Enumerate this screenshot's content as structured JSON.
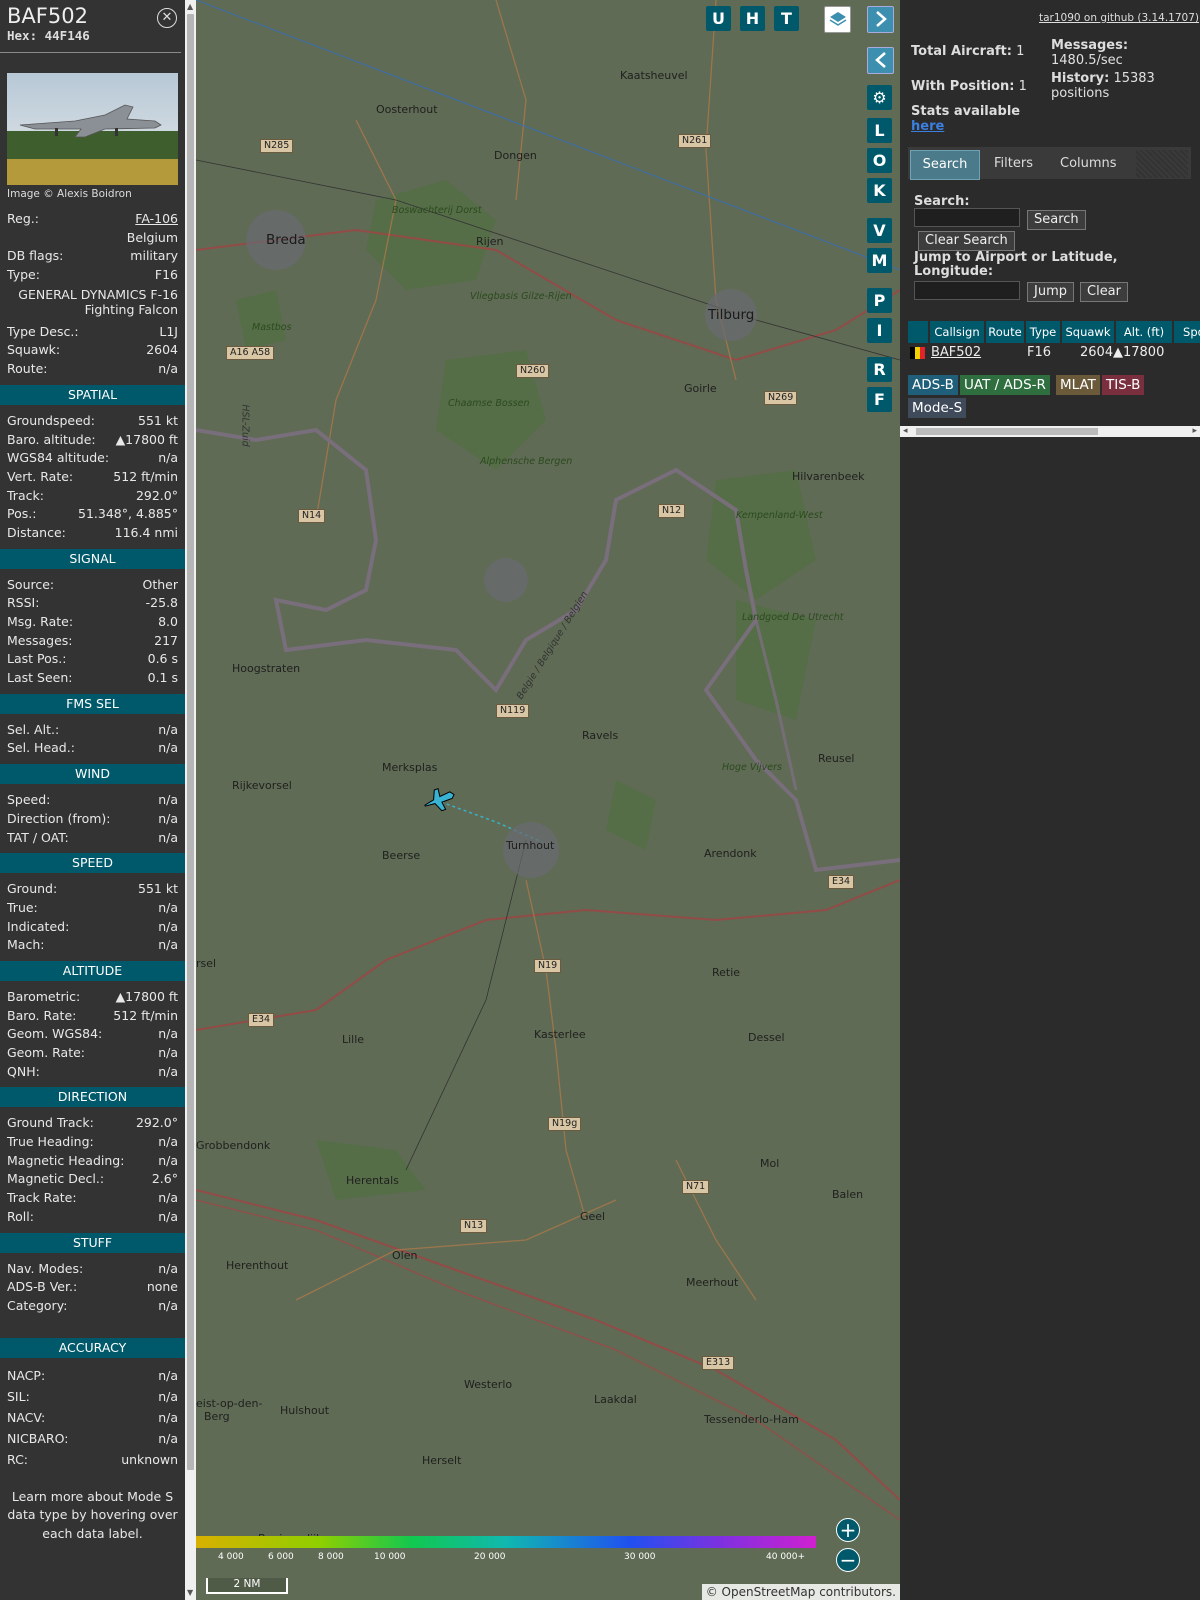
{
  "aircraft": {
    "callsign": "BAF502",
    "hex": "Hex: 44F146",
    "photo_credit": "Image © Alexis Boidron",
    "reg_label": "Reg.:",
    "reg": "FA-106",
    "country": "Belgium",
    "dbflags_label": "DB flags:",
    "dbflags": "military",
    "type_label": "Type:",
    "type": "F16",
    "type_full": "GENERAL DYNAMICS F-16 Fighting Falcon",
    "typedesc_label": "Type Desc.:",
    "typedesc": "L1J",
    "squawk_label": "Squawk:",
    "squawk": "2604",
    "route_label": "Route:",
    "route": "n/a"
  },
  "sections": [
    {
      "title": "SPATIAL",
      "rows": [
        {
          "k": "Groundspeed:",
          "v": "551 kt"
        },
        {
          "k": "Baro. altitude:",
          "v": "▲17800 ft"
        },
        {
          "k": "WGS84 altitude:",
          "v": "n/a"
        },
        {
          "k": "Vert. Rate:",
          "v": "512 ft/min"
        },
        {
          "k": "Track:",
          "v": "292.0°"
        },
        {
          "k": "Pos.:",
          "v": "51.348°, 4.885°"
        },
        {
          "k": "Distance:",
          "v": "116.4 nmi"
        }
      ]
    },
    {
      "title": "SIGNAL",
      "rows": [
        {
          "k": "Source:",
          "v": "Other"
        },
        {
          "k": "RSSI:",
          "v": "-25.8"
        },
        {
          "k": "Msg. Rate:",
          "v": "8.0"
        },
        {
          "k": "Messages:",
          "v": "217"
        },
        {
          "k": "Last Pos.:",
          "v": "0.6 s"
        },
        {
          "k": "Last Seen:",
          "v": "0.1 s"
        }
      ]
    },
    {
      "title": "FMS SEL",
      "rows": [
        {
          "k": "Sel. Alt.:",
          "v": "n/a"
        },
        {
          "k": "Sel. Head.:",
          "v": "n/a"
        }
      ]
    },
    {
      "title": "WIND",
      "rows": [
        {
          "k": "Speed:",
          "v": "n/a"
        },
        {
          "k": "Direction (from):",
          "v": "n/a"
        },
        {
          "k": "TAT / OAT:",
          "v": "n/a"
        }
      ]
    },
    {
      "title": "SPEED",
      "rows": [
        {
          "k": "Ground:",
          "v": "551 kt"
        },
        {
          "k": "True:",
          "v": "n/a"
        },
        {
          "k": "Indicated:",
          "v": "n/a"
        },
        {
          "k": "Mach:",
          "v": "n/a"
        }
      ]
    },
    {
      "title": "ALTITUDE",
      "rows": [
        {
          "k": "Barometric:",
          "v": "▲17800 ft"
        },
        {
          "k": "Baro. Rate:",
          "v": "512 ft/min"
        },
        {
          "k": "Geom. WGS84:",
          "v": "n/a"
        },
        {
          "k": "Geom. Rate:",
          "v": "n/a"
        },
        {
          "k": "QNH:",
          "v": "n/a"
        }
      ]
    },
    {
      "title": "DIRECTION",
      "rows": [
        {
          "k": "Ground Track:",
          "v": "292.0°"
        },
        {
          "k": "True Heading:",
          "v": "n/a"
        },
        {
          "k": "Magnetic Heading:",
          "v": "n/a"
        },
        {
          "k": "Magnetic Decl.:",
          "v": "2.6°"
        },
        {
          "k": "Track Rate:",
          "v": "n/a"
        },
        {
          "k": "Roll:",
          "v": "n/a"
        }
      ]
    },
    {
      "title": "STUFF",
      "rows": [
        {
          "k": "Nav. Modes:",
          "v": "n/a"
        },
        {
          "k": "ADS-B Ver.:",
          "v": "none"
        },
        {
          "k": "Category:",
          "v": "n/a"
        }
      ]
    },
    {
      "title": "ACCURACY",
      "rows": [
        {
          "k": "NACP:",
          "v": "n/a"
        },
        {
          "k": "SIL:",
          "v": "n/a"
        },
        {
          "k": "NACV:",
          "v": "n/a"
        },
        {
          "k": "NICBARO:",
          "v": "n/a"
        },
        {
          "k": "RC:",
          "v": "unknown"
        }
      ]
    }
  ],
  "learn_more": "Learn more about Mode S data type by hovering over each data label.",
  "map": {
    "top_buttons": [
      "U",
      "H",
      "T"
    ],
    "side_buttons": [
      "L",
      "O",
      "K",
      "V",
      "M",
      "P",
      "I",
      "R",
      "F"
    ],
    "attribution": "© OpenStreetMap contributors.",
    "scale": "2 NM",
    "altitude_legend": [
      "4 000",
      "6 000",
      "8 000",
      "10 000",
      "20 000",
      "30 000",
      "40 000+"
    ],
    "places": [
      "Breda",
      "Tilburg",
      "Oosterhout",
      "Dongen",
      "Kaatsheuvel",
      "Rijen",
      "Goirle",
      "Hilvarenbeek",
      "Hoogstraten",
      "Merksplas",
      "Rijkevorsel",
      "Ravels",
      "Turnhout",
      "Beerse",
      "Arendonk",
      "Reusel",
      "Retie",
      "Kasterlee",
      "Dessel",
      "Lille",
      "Grobbendonk",
      "Herentals",
      "Geel",
      "Mol",
      "Balen",
      "Olen",
      "Herenthout",
      "Meerhout",
      "Westerlo",
      "Laakdal",
      "Hulshout",
      "Herselt",
      "Tessenderlo-Ham",
      "Beginendijk",
      "Berg",
      "rsel",
      "eist-op-den-"
    ],
    "roads": [
      "N285",
      "N261",
      "N260",
      "N269",
      "N14",
      "N12",
      "N119",
      "N19",
      "N19g",
      "N71",
      "N13",
      "E313",
      "E34",
      "E34",
      "A16 A58"
    ],
    "areas": [
      "Boswachterij Dorst",
      "Vliegbasis Gilze-Rijen",
      "Mastbos",
      "Chaamse Bossen",
      "Alphensche Bergen",
      "Kempenland-West",
      "Landgoed De Utrecht",
      "Hoge Vijvers",
      "Belgie / Belgique / Belgien",
      "HSL-Zuid"
    ]
  },
  "stats": {
    "total_label": "Total Aircraft:",
    "total": "1",
    "withpos_label": "With Position:",
    "withpos": "1",
    "messages_label": "Messages:",
    "messages": "1480.5/sec",
    "history_label": "History:",
    "history": "15383 positions",
    "stats_label": "Stats available",
    "stats_link": "here",
    "github": "tar1090 on github (3.14.1707)"
  },
  "tabs": [
    "Search",
    "Filters",
    "Columns"
  ],
  "search": {
    "label": "Search:",
    "search_button": "Search",
    "clear_button": "Clear Search",
    "jump_label": "Jump to Airport or Latitude, Longitude:",
    "jump_button": "Jump",
    "jump_clear_button": "Clear"
  },
  "table": {
    "headers": [
      "Callsign",
      "Route",
      "Type",
      "Squawk",
      "Alt. (ft)",
      "Spd"
    ],
    "row": {
      "callsign": "BAF502",
      "type": "F16",
      "squawk": "2604",
      "alt": "▲17800"
    }
  },
  "sources": [
    {
      "label": "ADS-B",
      "color": "#1f5f7a"
    },
    {
      "label": "UAT / ADS-R",
      "color": "#2f6f3f"
    },
    {
      "label": "MLAT",
      "color": "#6b5a3a"
    },
    {
      "label": "TIS-B",
      "color": "#7a2f3f"
    },
    {
      "label": "Mode-S",
      "color": "#3f4a5a"
    }
  ]
}
